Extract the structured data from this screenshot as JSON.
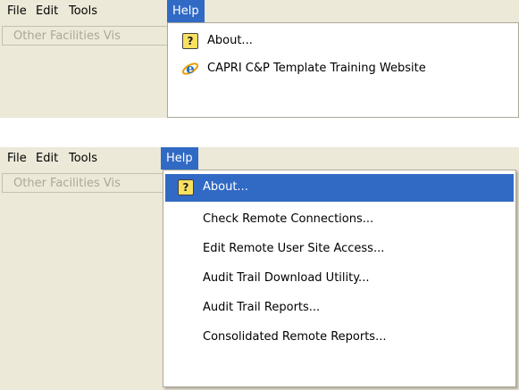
{
  "menubar": {
    "items": [
      {
        "label": "File"
      },
      {
        "label": "Edit"
      },
      {
        "label": "Tools"
      },
      {
        "label": "Help"
      }
    ]
  },
  "toolbar": {
    "facility_button_label": "Other Facilities Vis"
  },
  "help_menu_collapsed": {
    "items": [
      {
        "label": "About...",
        "icon": "about-icon"
      },
      {
        "label": "CAPRI C&P Template Training Website",
        "icon": "internet-explorer-icon"
      }
    ]
  },
  "help_menu_expanded": {
    "items": [
      {
        "label": "About...",
        "icon": "about-icon",
        "highlighted": true
      },
      {
        "label": "Check Remote Connections..."
      },
      {
        "label": "Edit Remote User Site Access..."
      },
      {
        "label": "Audit Trail Download Utility..."
      },
      {
        "label": "Audit Trail Reports..."
      },
      {
        "label": "Consolidated Remote Reports..."
      }
    ]
  },
  "colors": {
    "menu_highlight": "#316ac5",
    "chrome_background": "#ece9d8",
    "disabled_text": "#aca899"
  }
}
